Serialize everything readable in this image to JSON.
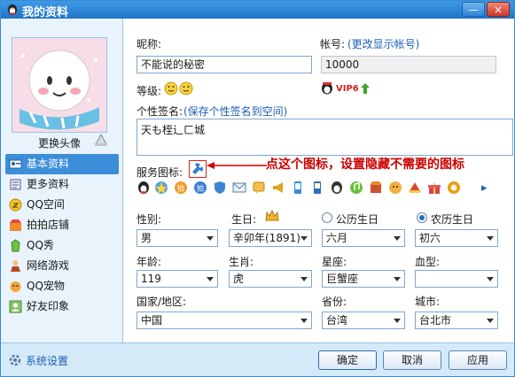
{
  "window": {
    "title": "我的资料",
    "min_label": "—",
    "close_label": "×"
  },
  "sidebar": {
    "change_avatar": "更换头像",
    "items": [
      {
        "label": "基本资料",
        "icon": "id-card-icon",
        "active": true
      },
      {
        "label": "更多资料",
        "icon": "more-info-icon"
      },
      {
        "label": "QQ空间",
        "icon": "qzone-icon"
      },
      {
        "label": "拍拍店铺",
        "icon": "paipai-shop-icon"
      },
      {
        "label": "QQ秀",
        "icon": "qq-show-icon"
      },
      {
        "label": "网络游戏",
        "icon": "game-icon"
      },
      {
        "label": "QQ宠物",
        "icon": "qq-pet-icon"
      },
      {
        "label": "好友印象",
        "icon": "friend-impression-icon"
      }
    ]
  },
  "profile": {
    "nickname_label": "昵称:",
    "nickname_value": "不能说的秘密",
    "account_label": "帐号:",
    "account_link": "(更改显示帐号)",
    "account_value": "10000",
    "level_label": "等级:",
    "vip_label": "VIP6",
    "signature_label": "个性签名:",
    "signature_link": "(保存个性签名到空间)",
    "signature_value": "天も桎辶ㄈ城",
    "service_label": "服务图标:",
    "annotation": "点这个图标，设置隐藏不需要的图标",
    "more_arrow": "▸"
  },
  "form": {
    "gender_label": "性别:",
    "gender_value": "男",
    "birthday_label": "生日:",
    "year_value": "辛卯年(1891)",
    "month_value": "六月",
    "solar_label": "公历生日",
    "lunar_label": "农历生日",
    "day_value": "初六",
    "age_label": "年龄:",
    "age_value": "119",
    "zodiac_label": "生肖:",
    "zodiac_value": "虎",
    "constellation_label": "星座:",
    "constellation_value": "巨蟹座",
    "blood_label": "血型:",
    "blood_value": "",
    "country_label": "国家/地区:",
    "country_value": "中国",
    "province_label": "省份:",
    "province_value": "台湾",
    "city_label": "城市:",
    "city_value": "台北市"
  },
  "footer": {
    "settings": "系统设置",
    "ok": "确定",
    "cancel": "取消",
    "apply": "应用"
  },
  "colors": {
    "title_bar": "#1f74c6",
    "annotation": "#cc0000",
    "link": "#1e5fb4"
  }
}
